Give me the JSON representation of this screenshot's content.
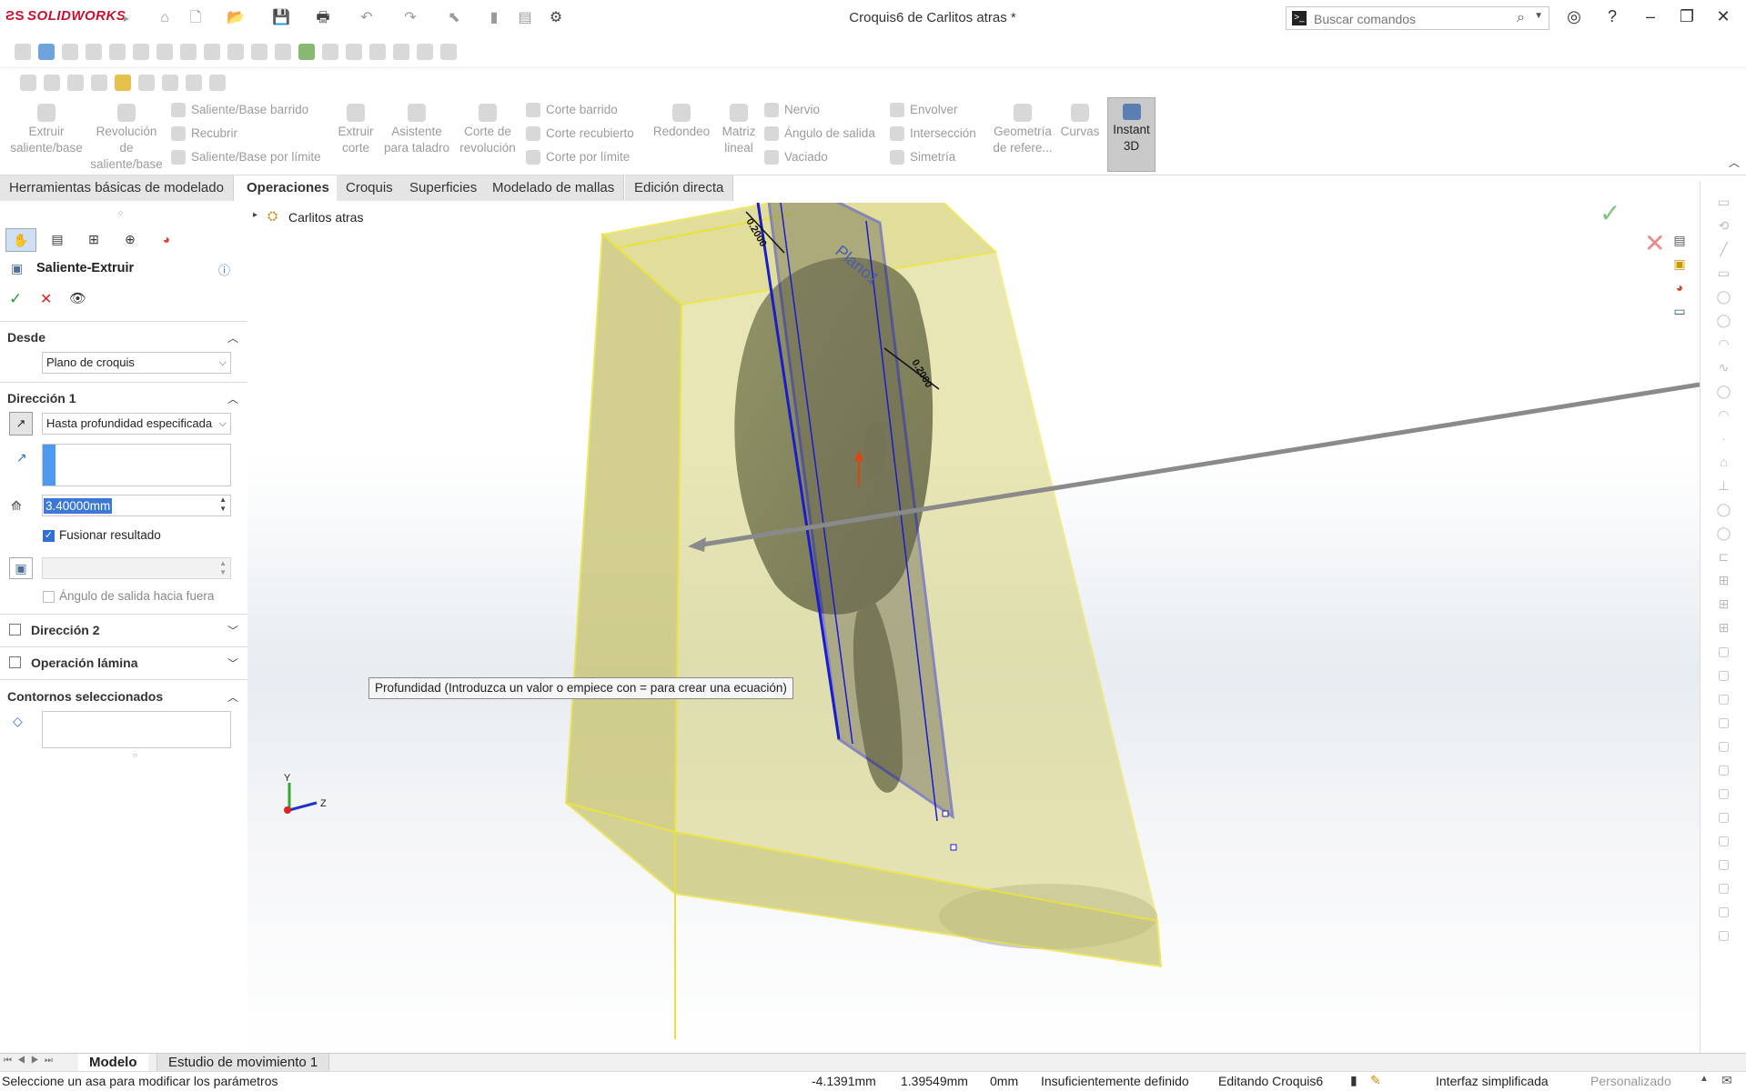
{
  "app": {
    "brand": "SOLIDWORKS",
    "document_title": "Croquis6 de Carlitos atras *"
  },
  "search": {
    "placeholder": "Buscar comandos"
  },
  "command_manager": {
    "buttons": {
      "extrude_boss": "Extruir saliente/base",
      "revolve_boss": "Revolución de saliente/base",
      "swept_boss": "Saliente/Base barrido",
      "loft_boss": "Recubrir",
      "boundary_boss": "Saliente/Base por límite",
      "extruded_cut": "Extruir corte",
      "hole_wizard": "Asistente para taladro",
      "revolved_cut": "Corte de revolución",
      "swept_cut": "Corte barrido",
      "lofted_cut": "Corte recubierto",
      "boundary_cut": "Corte por límite",
      "fillet": "Redondeo",
      "linear_pattern": "Matriz lineal",
      "rib": "Nervio",
      "draft": "Ángulo de salida",
      "shell": "Vaciado",
      "wrap": "Envolver",
      "intersect": "Intersección",
      "mirror": "Simetría",
      "ref_geometry": "Geometría de refere...",
      "curves": "Curvas",
      "instant3d": "Instant 3D"
    }
  },
  "tabs": [
    "Herramientas básicas de modelado",
    "Operaciones",
    "Croquis",
    "Superficies",
    "Modelado de mallas",
    "Edición directa"
  ],
  "tree": {
    "root": "Carlitos atras"
  },
  "property_manager": {
    "title": "Saliente-Extruir",
    "desde": {
      "label": "Desde",
      "value": "Plano de croquis"
    },
    "direccion1": {
      "label": "Dirección 1",
      "end_condition": "Hasta profundidad especificada",
      "depth": "3.40000mm",
      "merge_label": "Fusionar resultado",
      "merge_checked": true,
      "draft_outward_label": "Ángulo de salida hacia fuera"
    },
    "direccion2": {
      "label": "Dirección 2"
    },
    "thin_feature": {
      "label": "Operación lámina"
    },
    "selected_contours": {
      "label": "Contornos seleccionados"
    }
  },
  "tooltip": "Profundidad (Introduzca un valor o empiece con = para crear una ecuación)",
  "viewport": {
    "plane_label": "Plano1",
    "dimension_label_1": "0.2000",
    "dimension_label_2": "0.2000",
    "triad": {
      "y": "Y",
      "z": "Z"
    }
  },
  "bottom_tabs": [
    "Modelo",
    "Estudio de movimiento 1"
  ],
  "status": {
    "message": "Seleccione un asa para modificar los parámetros",
    "x": "-4.1391mm",
    "y": "1.39549mm",
    "z": "0mm",
    "definition": "Insuficientemente definido",
    "editing": "Editando Croquis6",
    "interface": "Interfaz simplificada",
    "units": "Personalizado"
  },
  "colors": {
    "accent_blue": "#2f6fd6",
    "brand_red": "#c8102e",
    "body_yellow": "#e6e27a",
    "plane_blue": "#1a1ad0"
  }
}
